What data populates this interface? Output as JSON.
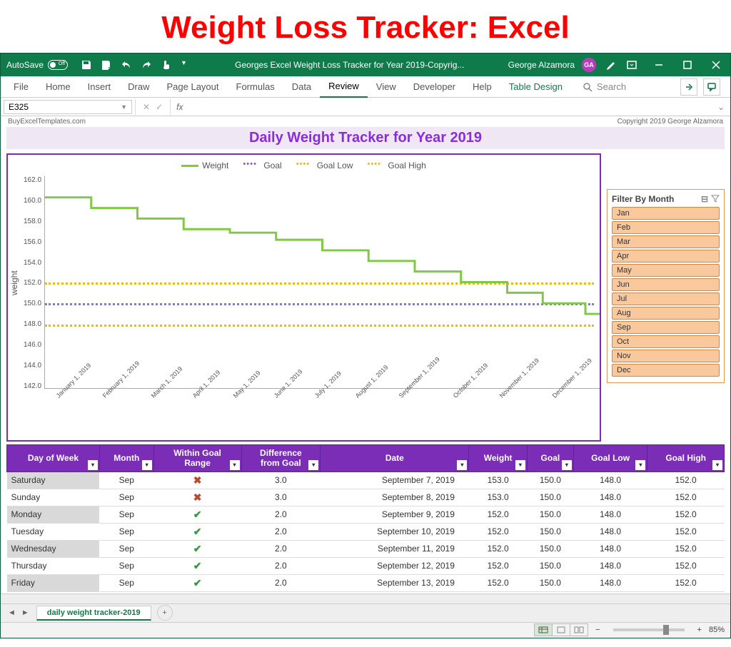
{
  "page_heading": "Weight Loss Tracker: Excel",
  "titlebar": {
    "autosave_label": "AutoSave",
    "autosave_state": "Off",
    "document_title": "Georges Excel Weight Loss Tracker for Year 2019-Copyrig...",
    "user_name": "George Alzamora",
    "user_initials": "GA"
  },
  "ribbon": {
    "tabs": [
      "File",
      "Home",
      "Insert",
      "Draw",
      "Page Layout",
      "Formulas",
      "Data",
      "Review",
      "View",
      "Developer",
      "Help",
      "Table Design"
    ],
    "active_tab": "Review",
    "context_tab": "Table Design",
    "search_placeholder": "Search"
  },
  "name_box": "E325",
  "formula_bar": "",
  "sheet_info": {
    "left": "BuyExcelTemplates.com",
    "right": "Copyright 2019  George Alzamora"
  },
  "chart_title": "Daily Weight Tracker for Year 2019",
  "legend": {
    "weight": "Weight",
    "goal": "Goal",
    "goal_low": "Goal Low",
    "goal_high": "Goal High"
  },
  "chart_data": {
    "type": "line",
    "title": "Daily Weight Tracker for Year 2019",
    "ylabel": "weight",
    "ylim": [
      142,
      162
    ],
    "y_ticks": [
      "162.0",
      "160.0",
      "158.0",
      "156.0",
      "154.0",
      "152.0",
      "150.0",
      "148.0",
      "146.0",
      "144.0",
      "142.0"
    ],
    "x_labels": [
      "January 1, 2019",
      "February 1, 2019",
      "March 1, 2019",
      "April 1, 2019",
      "May 1, 2019",
      "June 1, 2019",
      "July 1, 2019",
      "August 1, 2019",
      "September 1, 2019",
      "October 1, 2019",
      "November 1, 2019",
      "December 1, 2019"
    ],
    "series": [
      {
        "name": "Weight",
        "type": "step",
        "color": "#7fc943",
        "values": [
          160,
          159,
          158,
          157,
          157,
          156,
          155,
          154,
          153,
          152,
          151,
          150,
          149
        ]
      },
      {
        "name": "Goal",
        "type": "dotted",
        "color": "#8679c4",
        "value": 150
      },
      {
        "name": "Goal Low",
        "type": "dotted",
        "color": "#e8b823",
        "value": 148
      },
      {
        "name": "Goal High",
        "type": "dotted",
        "color": "#e8b823",
        "value": 152
      }
    ]
  },
  "slicer": {
    "title": "Filter By Month",
    "items": [
      "Jan",
      "Feb",
      "Mar",
      "Apr",
      "May",
      "Jun",
      "Jul",
      "Aug",
      "Sep",
      "Oct",
      "Nov",
      "Dec"
    ]
  },
  "table": {
    "headers": [
      "Day of Week",
      "Month",
      "Within Goal Range",
      "Difference from Goal",
      "Date",
      "Weight",
      "Goal",
      "Goal Low",
      "Goal High"
    ],
    "rows": [
      {
        "day": "Saturday",
        "month": "Sep",
        "within": false,
        "diff": "3.0",
        "date": "September 7, 2019",
        "weight": "153.0",
        "goal": "150.0",
        "low": "148.0",
        "high": "152.0"
      },
      {
        "day": "Sunday",
        "month": "Sep",
        "within": false,
        "diff": "3.0",
        "date": "September 8, 2019",
        "weight": "153.0",
        "goal": "150.0",
        "low": "148.0",
        "high": "152.0"
      },
      {
        "day": "Monday",
        "month": "Sep",
        "within": true,
        "diff": "2.0",
        "date": "September 9, 2019",
        "weight": "152.0",
        "goal": "150.0",
        "low": "148.0",
        "high": "152.0"
      },
      {
        "day": "Tuesday",
        "month": "Sep",
        "within": true,
        "diff": "2.0",
        "date": "September 10, 2019",
        "weight": "152.0",
        "goal": "150.0",
        "low": "148.0",
        "high": "152.0"
      },
      {
        "day": "Wednesday",
        "month": "Sep",
        "within": true,
        "diff": "2.0",
        "date": "September 11, 2019",
        "weight": "152.0",
        "goal": "150.0",
        "low": "148.0",
        "high": "152.0"
      },
      {
        "day": "Thursday",
        "month": "Sep",
        "within": true,
        "diff": "2.0",
        "date": "September 12, 2019",
        "weight": "152.0",
        "goal": "150.0",
        "low": "148.0",
        "high": "152.0"
      },
      {
        "day": "Friday",
        "month": "Sep",
        "within": true,
        "diff": "2.0",
        "date": "September 13, 2019",
        "weight": "152.0",
        "goal": "150.0",
        "low": "148.0",
        "high": "152.0"
      }
    ]
  },
  "sheet_tab_name": "daily weight tracker-2019",
  "zoom": "85%"
}
